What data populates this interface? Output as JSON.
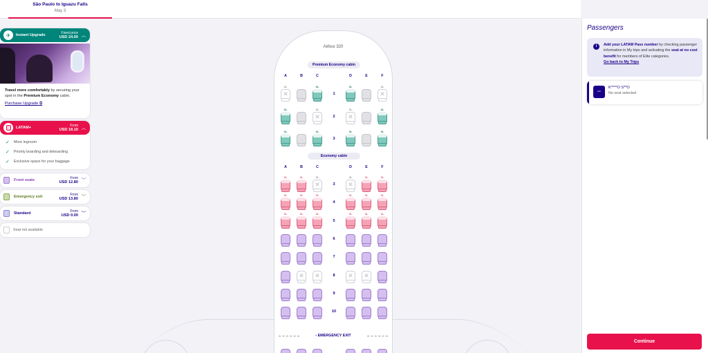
{
  "header": {
    "route": "São Paulo to Iguazu Falls",
    "date": "May 3"
  },
  "categories": {
    "upgrade": {
      "name": "Instant Upgrade",
      "price_label": "Fixed price",
      "price": "USD 24.00",
      "text_bold": "Travel more comfortably",
      "text_1": " by securing your spot in the ",
      "text_bold2": "Premium Economy",
      "text_2": " cabin.",
      "link": "Purchase Upgrade",
      "color": "#00857a"
    },
    "latam_plus": {
      "name": "LATAM+",
      "price_label": "From",
      "price": "USD 18.10",
      "color": "#e8114b",
      "features": [
        "More legroom",
        "Priority boarding and deboarding",
        "Exclusive space for your baggage"
      ]
    },
    "front": {
      "name": "Front seats",
      "price_label": "From",
      "price": "USD 12.80",
      "color": "#8a3fb8"
    },
    "exit": {
      "name": "Emergency exit",
      "price_label": "From",
      "price": "USD 13.80",
      "color": "#6b8e23"
    },
    "standard": {
      "name": "Standard",
      "price_label": "From",
      "price": "USD 0.00",
      "color": "#1b0088"
    },
    "unavailable": {
      "name": "Seat not available"
    }
  },
  "seatmap": {
    "aircraft": "Airbus 320",
    "premium_cabin": "Premium Economy cabin",
    "economy_cabin": "Economy cabin",
    "columns": [
      "A",
      "B",
      "C",
      "D",
      "E",
      "F"
    ],
    "xl": "XL",
    "premium_rows": [
      {
        "row": "1",
        "seats": [
          "na",
          "grey",
          "prem",
          "prem",
          "grey",
          "na"
        ]
      },
      {
        "row": "2",
        "seats": [
          "prem",
          "grey",
          "na",
          "na",
          "grey",
          "prem"
        ]
      },
      {
        "row": "3",
        "seats": [
          "prem",
          "grey",
          "prem",
          "prem",
          "grey",
          "prem"
        ]
      }
    ],
    "economy_rows": [
      {
        "row": "3",
        "seats": [
          "latam",
          "latam",
          "na",
          "na",
          "latam",
          "latam"
        ]
      },
      {
        "row": "4",
        "seats": [
          "latam",
          "latam",
          "latam",
          "latam",
          "latam",
          "latam"
        ]
      },
      {
        "row": "5",
        "seats": [
          "latam",
          "latam",
          "latam",
          "latam",
          "latam",
          "latam"
        ]
      },
      {
        "row": "6",
        "seats": [
          "front",
          "front",
          "front",
          "front",
          "front",
          "front"
        ]
      },
      {
        "row": "7",
        "seats": [
          "front",
          "front",
          "front",
          "front",
          "front",
          "front"
        ]
      },
      {
        "row": "8",
        "seats": [
          "front",
          "na",
          "na",
          "na",
          "na",
          "front"
        ]
      },
      {
        "row": "9",
        "seats": [
          "front",
          "front",
          "front",
          "front",
          "front",
          "front"
        ]
      },
      {
        "row": "10",
        "seats": [
          "front",
          "front",
          "front",
          "front",
          "front",
          "front"
        ]
      }
    ],
    "emergency_exit": "EMERGENCY EXIT"
  },
  "passengers": {
    "title": "Passengers",
    "notice_bold1": "Add your LATAM Pass number",
    "notice_1": " by checking passenger information in My trips and activating the ",
    "notice_bold2": "seat at no cost benefit",
    "notice_2": " for members of Elite categories.",
    "notice_link": "Go back to My Trips",
    "passenger": {
      "number": "--",
      "name": "K****O S**O",
      "seat": "No seat selected"
    }
  },
  "continue_label": "Continue"
}
